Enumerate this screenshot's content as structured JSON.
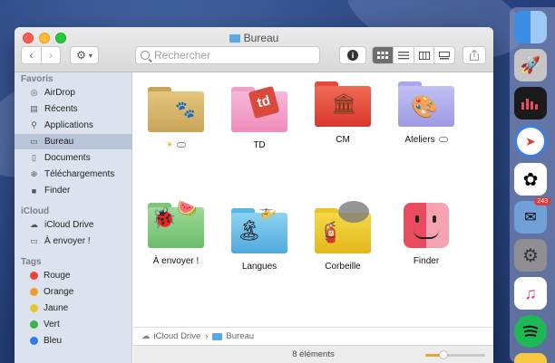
{
  "window": {
    "title": "Bureau",
    "search_placeholder": "Rechercher"
  },
  "sidebar": {
    "favorites_header": "Favoris",
    "favorites": [
      {
        "label": "AirDrop",
        "icon": "airdrop-icon"
      },
      {
        "label": "Récents",
        "icon": "clock-icon"
      },
      {
        "label": "Applications",
        "icon": "applications-icon"
      },
      {
        "label": "Bureau",
        "icon": "desktop-icon"
      },
      {
        "label": "Documents",
        "icon": "document-icon"
      },
      {
        "label": "Téléchargements",
        "icon": "download-icon"
      },
      {
        "label": "Finder",
        "icon": "folder-icon"
      }
    ],
    "icloud_header": "iCloud",
    "icloud": [
      {
        "label": "iCloud Drive",
        "icon": "cloud-icon"
      },
      {
        "label": "À envoyer !",
        "icon": "folder-icon"
      }
    ],
    "tags_header": "Tags",
    "tags": [
      {
        "label": "Rouge",
        "color": "#f0453a"
      },
      {
        "label": "Orange",
        "color": "#f39c2a"
      },
      {
        "label": "Jaune",
        "color": "#e8c62a"
      },
      {
        "label": "Vert",
        "color": "#39b54a"
      },
      {
        "label": "Bleu",
        "color": "#2b7de9"
      }
    ]
  },
  "items": [
    {
      "label": "",
      "icon": "paw-folder-icon"
    },
    {
      "label": "TD",
      "icon": "td-folder-icon"
    },
    {
      "label": "CM",
      "icon": "cm-folder-icon"
    },
    {
      "label": "Ateliers",
      "icon": "palette-folder-icon"
    },
    {
      "label": "À envoyer !",
      "icon": "ladybug-folder-icon"
    },
    {
      "label": "Langues",
      "icon": "island-folder-icon"
    },
    {
      "label": "Corbeille",
      "icon": "fire-extinguisher-folder-icon"
    },
    {
      "label": "Finder",
      "icon": "finder-icon"
    }
  ],
  "path_bar": {
    "root": "iCloud Drive",
    "separator": "›",
    "current": "Bureau"
  },
  "status": {
    "count": "8 éléments",
    "icon_size_level": 0.3
  },
  "dock": {
    "mail_badge": "243"
  }
}
